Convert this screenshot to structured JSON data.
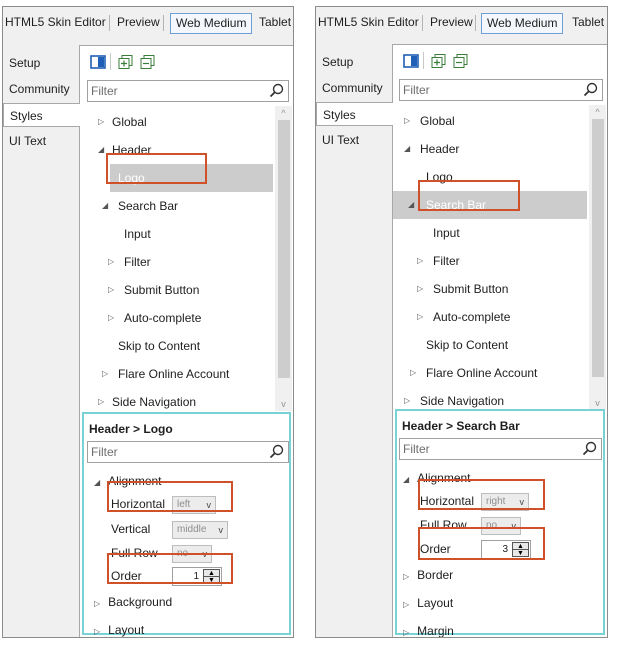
{
  "colors": {
    "highlight": "#d0502a",
    "properties_border": "#79d3d6",
    "selected_row": "#cccccc",
    "active_tab_border": "#6f9fd8"
  },
  "left": {
    "topbar": {
      "title": "HTML5 Skin Editor",
      "preview": "Preview",
      "web_medium": "Web Medium",
      "tablet": "Tablet"
    },
    "sidetabs": [
      "Setup",
      "Community",
      "Styles",
      "UI Text"
    ],
    "selected_sidetab": "Styles",
    "toolbar_icons": [
      "panel-icon",
      "add-item-icon",
      "remove-item-icon"
    ],
    "filter_placeholder": "Filter",
    "tree": [
      {
        "label": "Global",
        "arrow": "▷"
      },
      {
        "label": "Header",
        "arrow": "◢"
      },
      {
        "label": "Logo",
        "arrow": "",
        "selected": true
      },
      {
        "label": "Search Bar",
        "arrow": "◢"
      },
      {
        "label": "Input",
        "arrow": ""
      },
      {
        "label": "Filter",
        "arrow": "▷"
      },
      {
        "label": "Submit Button",
        "arrow": "▷"
      },
      {
        "label": "Auto-complete",
        "arrow": "▷"
      },
      {
        "label": "Skip to Content",
        "arrow": ""
      },
      {
        "label": "Flare Online Account",
        "arrow": "▷"
      },
      {
        "label": "Side Navigation",
        "arrow": "▷"
      }
    ],
    "breadcrumb": "Header > Logo",
    "props_filter_placeholder": "Filter",
    "props": {
      "group": "Alignment",
      "horizontal_label": "Horizontal",
      "horizontal_value": "left",
      "vertical_label": "Vertical",
      "vertical_value": "middle",
      "fullrow_label": "Full Row",
      "fullrow_value": "no",
      "order_label": "Order",
      "order_value": "1",
      "extra_groups": [
        "Background",
        "Layout"
      ]
    }
  },
  "right": {
    "topbar": {
      "title": "HTML5 Skin Editor",
      "preview": "Preview",
      "web_medium": "Web Medium",
      "tablet": "Tablet"
    },
    "sidetabs": [
      "Setup",
      "Community",
      "Styles",
      "UI Text"
    ],
    "selected_sidetab": "Styles",
    "toolbar_icons": [
      "panel-icon",
      "add-item-icon",
      "remove-item-icon"
    ],
    "filter_placeholder": "Filter",
    "tree": [
      {
        "label": "Global",
        "arrow": "▷"
      },
      {
        "label": "Header",
        "arrow": "◢"
      },
      {
        "label": "Logo",
        "arrow": ""
      },
      {
        "label": "Search Bar",
        "arrow": "◢",
        "selected": true
      },
      {
        "label": "Input",
        "arrow": ""
      },
      {
        "label": "Filter",
        "arrow": "▷"
      },
      {
        "label": "Submit Button",
        "arrow": "▷"
      },
      {
        "label": "Auto-complete",
        "arrow": "▷"
      },
      {
        "label": "Skip to Content",
        "arrow": ""
      },
      {
        "label": "Flare Online Account",
        "arrow": "▷"
      },
      {
        "label": "Side Navigation",
        "arrow": "▷"
      }
    ],
    "breadcrumb": "Header > Search Bar",
    "props_filter_placeholder": "Filter",
    "props": {
      "group": "Alignment",
      "horizontal_label": "Horizontal",
      "horizontal_value": "right",
      "fullrow_label": "Full Row",
      "fullrow_value": "no",
      "order_label": "Order",
      "order_value": "3",
      "extra_groups": [
        "Border",
        "Layout",
        "Margin"
      ]
    }
  }
}
